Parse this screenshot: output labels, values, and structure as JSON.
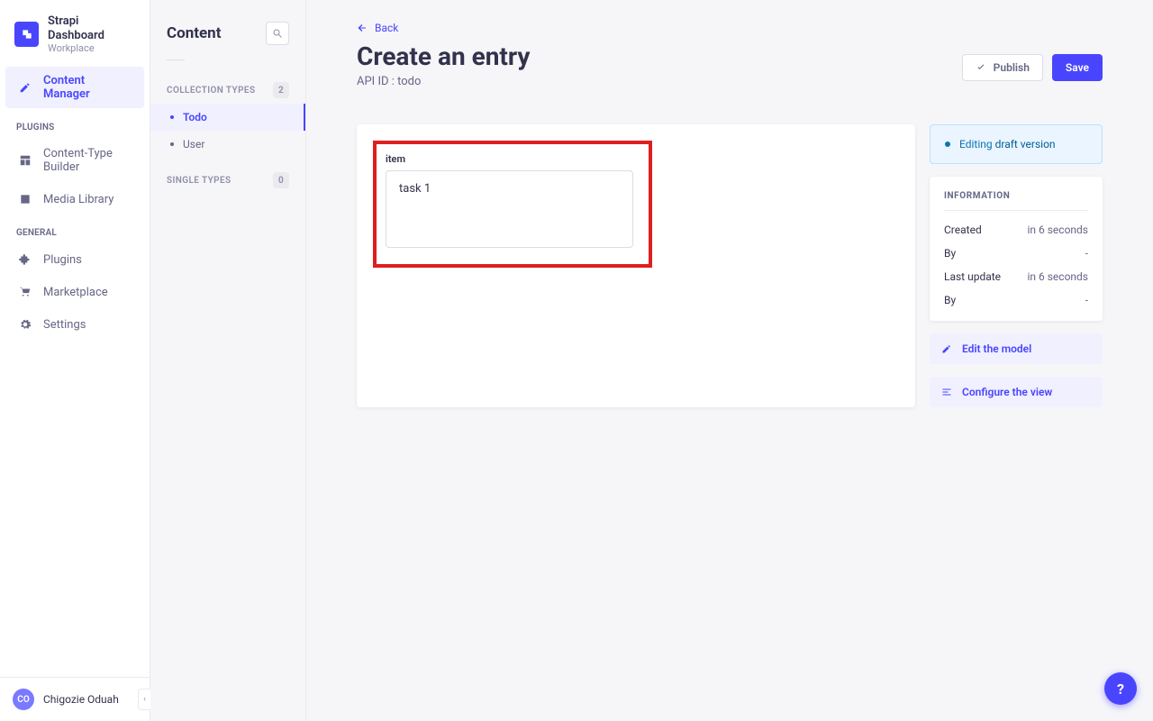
{
  "brand": {
    "title": "Strapi Dashboard",
    "subtitle": "Workplace",
    "logo_letter": "S"
  },
  "primary_nav": {
    "content_manager": "Content Manager",
    "plugins_header": "PLUGINS",
    "content_type_builder": "Content-Type Builder",
    "media_library": "Media Library",
    "general_header": "GENERAL",
    "plugins": "Plugins",
    "marketplace": "Marketplace",
    "settings": "Settings"
  },
  "user": {
    "initials": "CO",
    "name": "Chigozie Oduah"
  },
  "content_panel": {
    "title": "Content",
    "collection_types_label": "COLLECTION TYPES",
    "collection_types_count": "2",
    "collections": [
      {
        "label": "Todo",
        "active": true
      },
      {
        "label": "User",
        "active": false
      }
    ],
    "single_types_label": "SINGLE TYPES",
    "single_types_count": "0"
  },
  "main": {
    "back_label": "Back",
    "heading": "Create an entry",
    "api_id_label": "API ID : todo",
    "publish_label": "Publish",
    "save_label": "Save"
  },
  "form": {
    "item_label": "item",
    "item_value": "task 1"
  },
  "status": {
    "prefix": "Editing ",
    "suffix": "draft version"
  },
  "info": {
    "heading": "INFORMATION",
    "rows": [
      {
        "k": "Created",
        "v": "in 6 seconds"
      },
      {
        "k": "By",
        "v": "-"
      },
      {
        "k": "Last update",
        "v": "in 6 seconds"
      },
      {
        "k": "By",
        "v": "-"
      }
    ]
  },
  "rail_actions": {
    "edit_model": "Edit the model",
    "configure_view": "Configure the view"
  }
}
